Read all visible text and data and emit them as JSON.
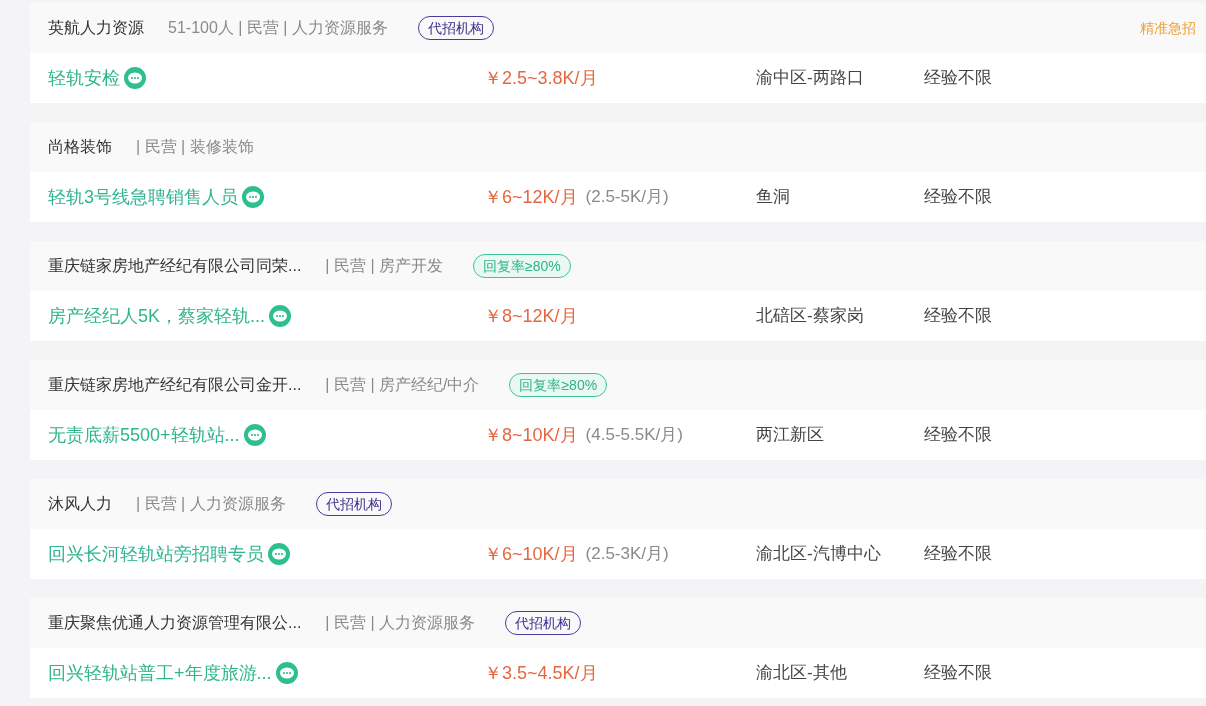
{
  "jobs": [
    {
      "company": "英航人力资源",
      "info": "51-100人 | 民营 | 人力资源服务",
      "tag": {
        "kind": "agency",
        "text": "代招机构"
      },
      "urgent_label": "精准急招",
      "title": "轻轨安检",
      "salary": "￥2.5~3.8K/月",
      "location": "渝中区-两路口",
      "experience": "经验不限"
    },
    {
      "company": "尚格装饰",
      "info": "| 民营 | 装修装饰",
      "title": "轻轨3号线急聘销售人员",
      "salary": "￥6~12K/月",
      "salary_note": "(2.5-5K/月)",
      "location": "鱼洞",
      "experience": "经验不限"
    },
    {
      "company": "重庆链家房地产经纪有限公司同荣...",
      "info": "| 民营 | 房产开发",
      "tag": {
        "kind": "reply_rate",
        "text": "回复率≥80%"
      },
      "title": "房产经纪人5K，蔡家轻轨...",
      "salary": "￥8~12K/月",
      "location": "北碚区-蔡家岗",
      "experience": "经验不限"
    },
    {
      "company": "重庆链家房地产经纪有限公司金开...",
      "info": "| 民营 | 房产经纪/中介",
      "tag": {
        "kind": "reply_rate",
        "text": "回复率≥80%"
      },
      "title": "无责底薪5500+轻轨站...",
      "salary": "￥8~10K/月",
      "salary_note": "(4.5-5.5K/月)",
      "location": "两江新区",
      "experience": "经验不限"
    },
    {
      "company": "沐风人力",
      "info": "| 民营 | 人力资源服务",
      "tag": {
        "kind": "agency",
        "text": "代招机构"
      },
      "title": "回兴长河轻轨站旁招聘专员",
      "salary": "￥6~10K/月",
      "salary_note": "(2.5-3K/月)",
      "location": "渝北区-汽博中心",
      "experience": "经验不限"
    },
    {
      "company": "重庆聚焦优通人力资源管理有限公...",
      "info": "| 民营 | 人力资源服务",
      "tag": {
        "kind": "agency",
        "text": "代招机构"
      },
      "title": "回兴轻轨站普工+年度旅游...",
      "salary": "￥3.5~4.5K/月",
      "location": "渝北区-其他",
      "experience": "经验不限"
    }
  ]
}
